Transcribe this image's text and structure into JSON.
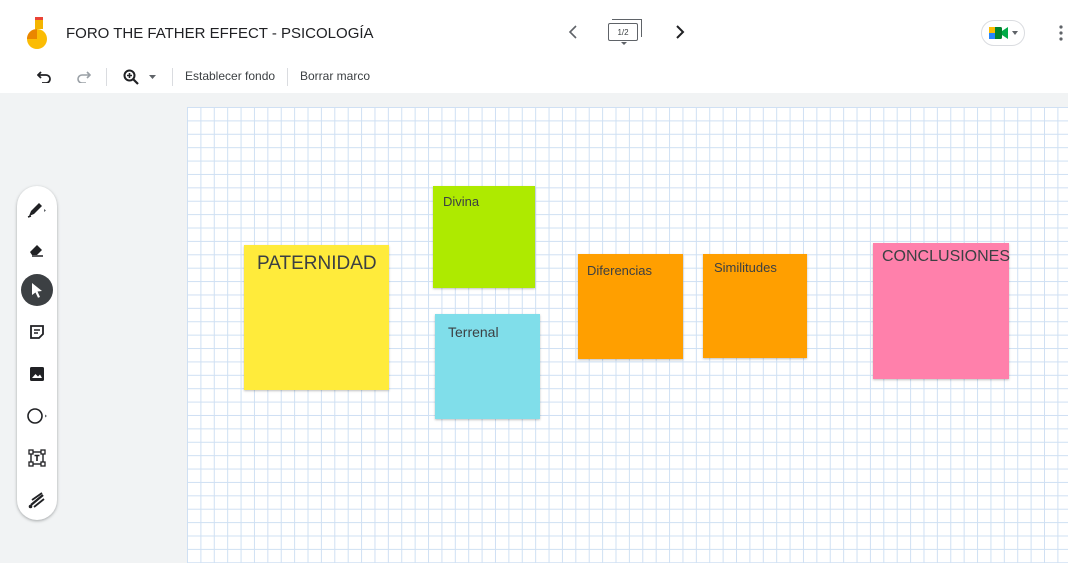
{
  "header": {
    "title": "FORO THE FATHER EFFECT - PSICOLOGÍA",
    "frame_indicator": "1/2",
    "logo_icon": "jamboard-logo-icon",
    "meet_icon": "google-meet-icon"
  },
  "toolbar": {
    "set_background": "Establecer fondo",
    "clear_frame": "Borrar marco"
  },
  "tools": [
    "pen-icon",
    "eraser-icon",
    "select-icon",
    "sticky-note-icon",
    "image-icon",
    "circle-shape-icon",
    "text-box-icon",
    "laser-icon"
  ],
  "notes": [
    {
      "text": "PATERNIDAD",
      "color": "#ffeb3b"
    },
    {
      "text": "Divina",
      "color": "#aeea00"
    },
    {
      "text": "Terrenal",
      "color": "#80deea"
    },
    {
      "text": "Diferencias",
      "color": "#ff9f00"
    },
    {
      "text": "Similitudes",
      "color": "#ff9f00"
    },
    {
      "text": "CONCLUSIONES",
      "color": "#ff80ab"
    }
  ],
  "colors": {
    "grid": "#cfe0f3",
    "canvas_bg": "#f1f3f4",
    "active_tool": "#3c4043"
  }
}
